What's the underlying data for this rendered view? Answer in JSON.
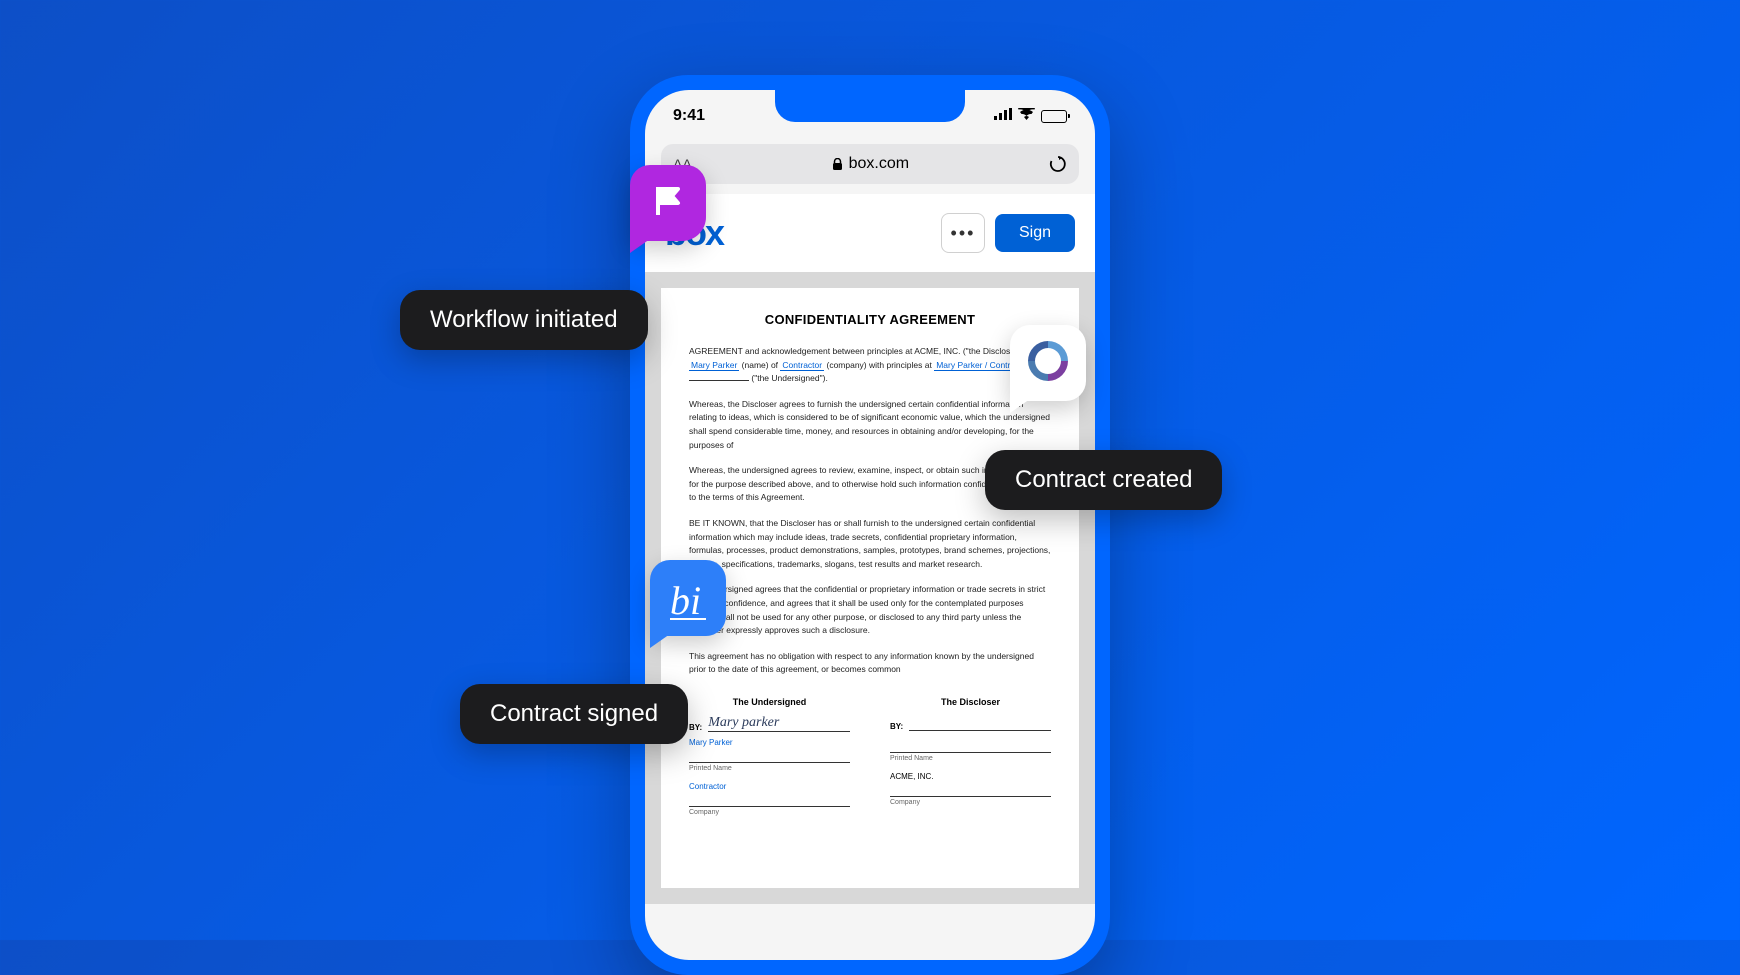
{
  "status_bar": {
    "time": "9:41"
  },
  "browser": {
    "aa_label": "AA",
    "url": "box.com"
  },
  "header": {
    "logo_text": "box",
    "more_label": "•••",
    "sign_label": "Sign"
  },
  "document": {
    "title": "CONFIDENTIALITY AGREEMENT",
    "intro_prefix": "AGREEMENT and acknowledgement between principles at ACME, INC. (\"the Discloser\") and",
    "name1": "Mary Parker",
    "label_name": "(name) of",
    "company1": "Contractor",
    "label_company": "(company) with principles at",
    "name2": "Mary Parker / Contractor",
    "label_undersigned": "(\"the Undersigned\").",
    "para1": "Whereas, the Discloser agrees to furnish the undersigned certain confidential information relating to ideas, which is considered to be of significant economic value, which the undersigned shall spend considerable time, money, and resources in obtaining and/or developing, for the purposes of",
    "para2": "Whereas, the undersigned agrees to review, examine, inspect, or obtain such information solely for the purpose described above, and to otherwise hold such information confidential pursuant to the terms of this Agreement.",
    "para3": "BE IT KNOWN, that the Discloser has or shall furnish to the undersigned certain confidential information which may include ideas, trade secrets, confidential proprietary information, formulas, processes, product demonstrations, samples, prototypes, brand schemes, projections, funding, specifications, trademarks, slogans, test results and market research.",
    "para4": "The undersigned agrees that the confidential or proprietary information or trade secrets in strict trust and confidence, and agrees that it shall be used only for the contemplated purposes above, shall not be used for any other purpose, or disclosed to any third party unless the Discloser expressly approves such a disclosure.",
    "para5": "This agreement has no obligation with respect to any information known by the undersigned prior to the date of this agreement, or becomes common",
    "signatures": {
      "left_title": "The Undersigned",
      "right_title": "The Discloser",
      "by_label": "BY:",
      "signature_name": "Mary parker",
      "printed_name_label": "Printed Name",
      "printed_name_left": "Mary Parker",
      "company_label": "Company",
      "company_left": "Contractor",
      "company_right": "ACME, INC."
    }
  },
  "overlays": {
    "workflow": "Workflow initiated",
    "contract_created": "Contract created",
    "contract_signed": "Contract signed",
    "blue_icon_text": "bi"
  }
}
